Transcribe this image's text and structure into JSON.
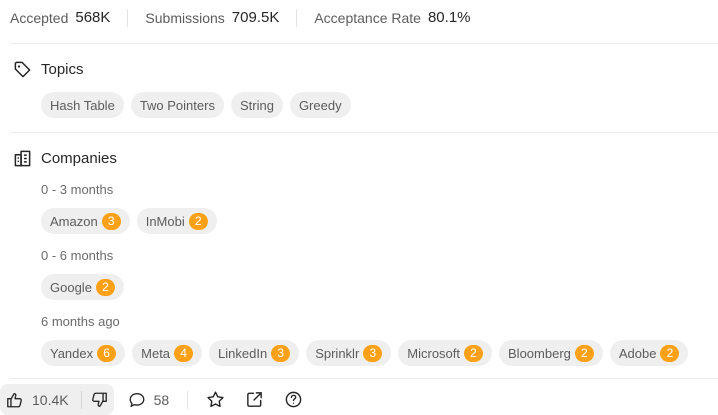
{
  "stats": {
    "accepted_label": "Accepted",
    "accepted_value": "568K",
    "submissions_label": "Submissions",
    "submissions_value": "709.5K",
    "acceptance_label": "Acceptance Rate",
    "acceptance_value": "80.1%"
  },
  "topics": {
    "title": "Topics",
    "icon": "tag-icon",
    "items": [
      "Hash Table",
      "Two Pointers",
      "String",
      "Greedy"
    ]
  },
  "companies": {
    "title": "Companies",
    "icon": "building-icon",
    "groups": [
      {
        "period": "0 - 3 months",
        "items": [
          {
            "name": "Amazon",
            "count": "3"
          },
          {
            "name": "InMobi",
            "count": "2"
          }
        ]
      },
      {
        "period": "0 - 6 months",
        "items": [
          {
            "name": "Google",
            "count": "2"
          }
        ]
      },
      {
        "period": "6 months ago",
        "items": [
          {
            "name": "Yandex",
            "count": "6"
          },
          {
            "name": "Meta",
            "count": "4"
          },
          {
            "name": "LinkedIn",
            "count": "3"
          },
          {
            "name": "Sprinklr",
            "count": "3"
          },
          {
            "name": "Microsoft",
            "count": "2"
          },
          {
            "name": "Bloomberg",
            "count": "2"
          },
          {
            "name": "Adobe",
            "count": "2"
          }
        ]
      }
    ]
  },
  "footer": {
    "likes": "10.4K",
    "comments": "58",
    "icons": [
      "thumbs-up-icon",
      "thumbs-down-icon",
      "comment-icon",
      "star-icon",
      "share-icon",
      "help-icon"
    ]
  },
  "colors": {
    "badge": "#ffa116",
    "chip_bg": "#efefef",
    "text": "#262626",
    "muted": "#5c5c5c"
  }
}
